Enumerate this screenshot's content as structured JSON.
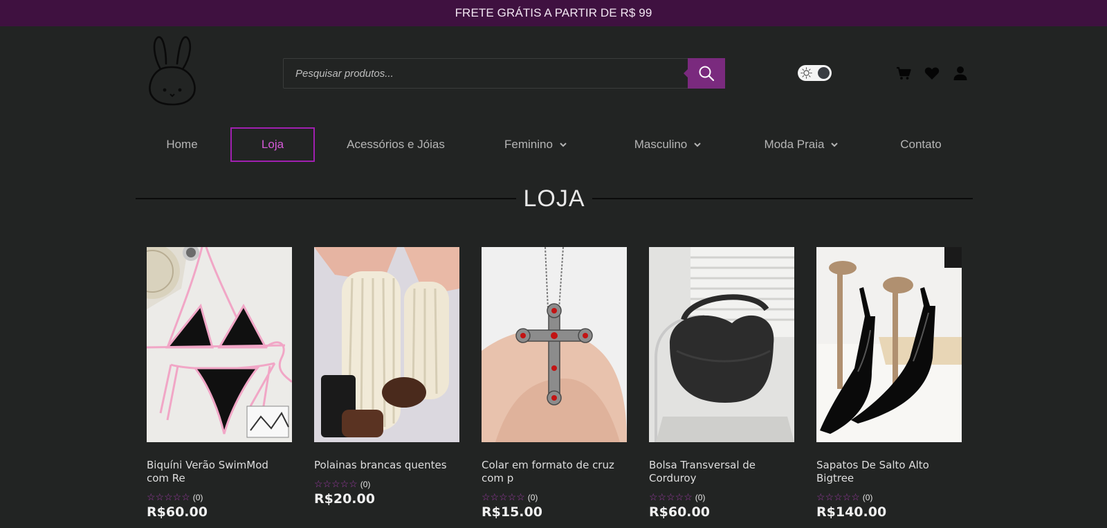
{
  "announcement": "FRETE GRÁTIS A PARTIR DE R$ 99",
  "search": {
    "placeholder": "Pesquisar produtos..."
  },
  "header_icons": [
    "search-icon",
    "sun-icon",
    "cart-icon",
    "heart-icon",
    "user-icon"
  ],
  "nav": {
    "items": [
      {
        "label": "Home",
        "dropdown": false,
        "active": false
      },
      {
        "label": "Loja",
        "dropdown": false,
        "active": true
      },
      {
        "label": "Acessórios e Jóias",
        "dropdown": false,
        "active": false
      },
      {
        "label": "Feminino",
        "dropdown": true,
        "active": false
      },
      {
        "label": "Masculino",
        "dropdown": true,
        "active": false
      },
      {
        "label": "Moda Praia",
        "dropdown": true,
        "active": false
      },
      {
        "label": "Contato",
        "dropdown": false,
        "active": false
      }
    ]
  },
  "page_title": "LOJA",
  "products": [
    {
      "name": "Biquíni Verão SwimMod com Re",
      "rating_count": "(0)",
      "price": "R$60.00"
    },
    {
      "name": "Polainas brancas quentes",
      "rating_count": "(0)",
      "price": "R$20.00"
    },
    {
      "name": "Colar em formato de cruz com p",
      "rating_count": "(0)",
      "price": "R$15.00"
    },
    {
      "name": "Bolsa Transversal de Corduroy",
      "rating_count": "(0)",
      "price": "R$60.00"
    },
    {
      "name": "Sapatos De Salto Alto Bigtree",
      "rating_count": "(0)",
      "price": "R$140.00"
    }
  ],
  "colors": {
    "accent": "#7a2a7e",
    "topbar": "#3f1140",
    "background": "#222423",
    "active_nav": "#a020b0",
    "stars": "#9b3aa3"
  }
}
